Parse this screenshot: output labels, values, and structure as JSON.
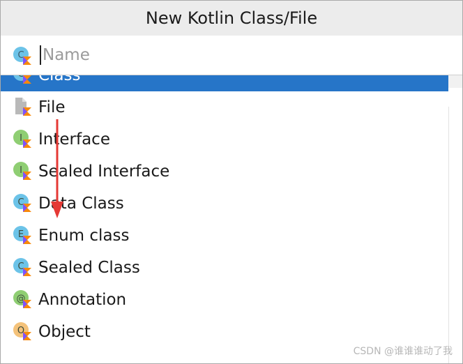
{
  "dialog": {
    "title": "New Kotlin Class/File",
    "search": {
      "value": "",
      "placeholder": "Name"
    },
    "items": [
      {
        "label": "Class",
        "icon": "class-icon",
        "letter": "C",
        "color": "#6cc3e8",
        "selected": true
      },
      {
        "label": "File",
        "icon": "file-icon",
        "letter": "",
        "color": "#b9b9b9",
        "selected": false
      },
      {
        "label": "Interface",
        "icon": "interface-icon",
        "letter": "I",
        "color": "#8fce73",
        "selected": false
      },
      {
        "label": "Sealed Interface",
        "icon": "sealed-interface-icon",
        "letter": "I",
        "color": "#8fce73",
        "selected": false
      },
      {
        "label": "Data Class",
        "icon": "data-class-icon",
        "letter": "C",
        "color": "#6cc3e8",
        "selected": false
      },
      {
        "label": "Enum class",
        "icon": "enum-class-icon",
        "letter": "E",
        "color": "#6cc3e8",
        "selected": false
      },
      {
        "label": "Sealed Class",
        "icon": "sealed-class-icon",
        "letter": "C",
        "color": "#6cc3e8",
        "selected": false
      },
      {
        "label": "Annotation",
        "icon": "annotation-icon",
        "letter": "@",
        "color": "#8fce73",
        "selected": false
      },
      {
        "label": "Object",
        "icon": "object-icon",
        "letter": "O",
        "color": "#f4c27a",
        "selected": false
      }
    ]
  },
  "watermark": "CSDN @谁谁谁动了我",
  "colors": {
    "selection": "#2675c8",
    "arrow": "#e53935",
    "kotlin_badge": [
      "#f88909",
      "#c757bc",
      "#7f52ff"
    ]
  }
}
